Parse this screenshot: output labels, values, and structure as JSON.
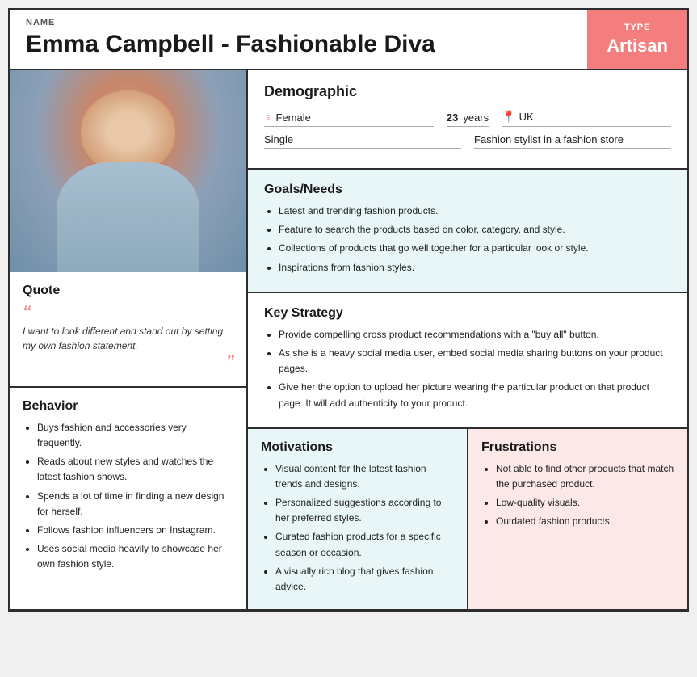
{
  "header": {
    "name_label": "NAME",
    "title": "Emma Campbell - Fashionable Diva",
    "type_label": "TYPE",
    "type_value": "Artisan"
  },
  "demographic": {
    "section_title": "Demographic",
    "gender": "Female",
    "age": "23",
    "age_label": "years",
    "location": "UK",
    "relationship": "Single",
    "occupation": "Fashion stylist in a fashion store"
  },
  "quote": {
    "section_title": "Quote",
    "text": "I want to look different and stand out by setting my own fashion statement."
  },
  "behavior": {
    "section_title": "Behavior",
    "items": [
      "Buys fashion and accessories very frequently.",
      "Reads about new styles and watches the latest fashion shows.",
      "Spends a lot of time in finding a new design for herself.",
      "Follows fashion influencers on Instagram.",
      "Uses social media heavily to showcase her own fashion style."
    ]
  },
  "goals": {
    "section_title": "Goals/Needs",
    "items": [
      "Latest and trending fashion products.",
      "Feature to search the products based on color, category, and style.",
      "Collections of products that go well together for a particular look or style.",
      "Inspirations from fashion styles."
    ]
  },
  "strategy": {
    "section_title": "Key Strategy",
    "items": [
      "Provide compelling cross product recommendations with a \"buy all\" button.",
      "As she is a heavy social media user, embed social media sharing buttons on your product pages.",
      "Give her the option to upload her picture wearing the particular product on that product page. It will add authenticity to your product."
    ]
  },
  "motivations": {
    "section_title": "Motivations",
    "items": [
      "Visual content for the latest fashion trends and designs.",
      "Personalized suggestions according to her preferred styles.",
      "Curated fashion products for a specific season or occasion.",
      "A visually rich blog that gives fashion advice."
    ]
  },
  "frustrations": {
    "section_title": "Frustrations",
    "items": [
      "Not able to find other products that match the purchased product.",
      "Low-quality visuals.",
      "Outdated fashion products."
    ]
  }
}
